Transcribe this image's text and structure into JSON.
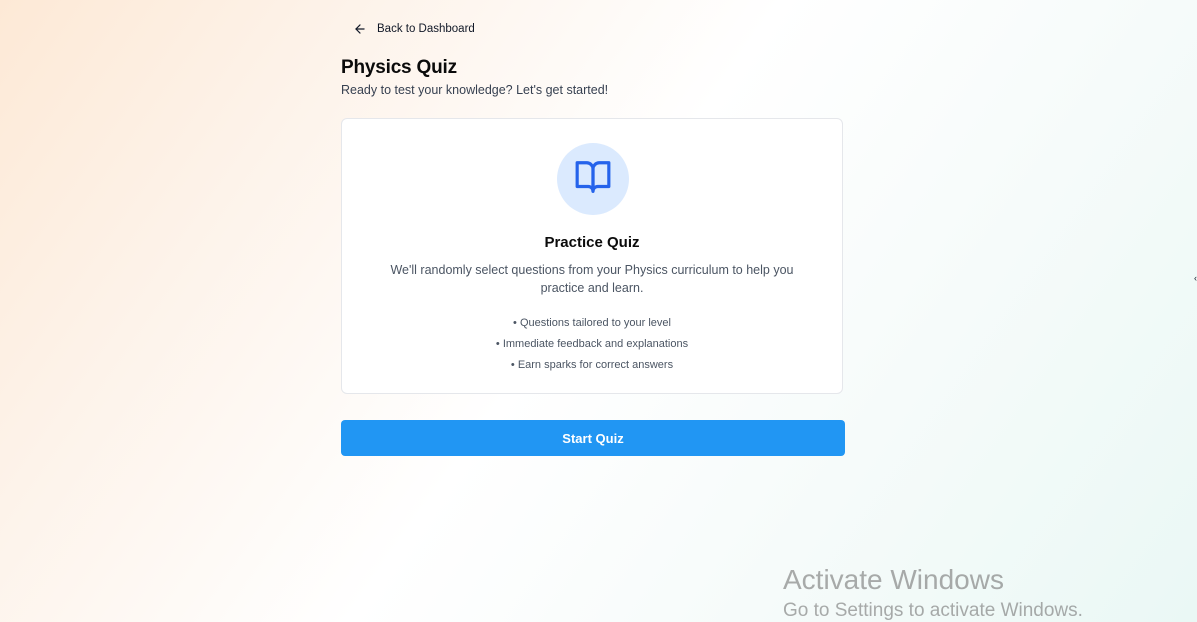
{
  "nav": {
    "back_label": "Back to Dashboard"
  },
  "page": {
    "title": "Physics Quiz",
    "subtitle": "Ready to test your knowledge? Let's get started!"
  },
  "card": {
    "icon": "open-book-icon",
    "title": "Practice Quiz",
    "description": "We'll randomly select questions from your Physics curriculum to help you practice and learn.",
    "features": [
      "Questions tailored to your level",
      "Immediate feedback and explanations",
      "Earn sparks for correct answers"
    ]
  },
  "actions": {
    "start_label": "Start Quiz"
  },
  "edge": {
    "arrow": "‹"
  },
  "watermark": {
    "title": "Activate Windows",
    "subtitle": "Go to Settings to activate Windows."
  },
  "colors": {
    "primary_button": "#2196f3",
    "icon_circle": "#dbeafe",
    "icon_stroke": "#2563eb"
  }
}
